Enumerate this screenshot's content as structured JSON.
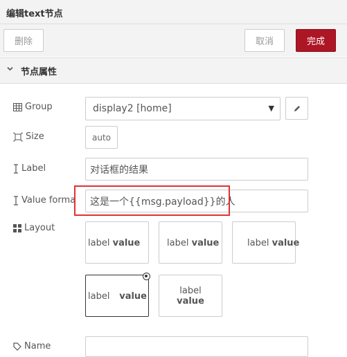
{
  "window": {
    "title": "编辑text节点"
  },
  "toolbar": {
    "delete_label": "删除",
    "cancel_label": "取消",
    "done_label": "完成"
  },
  "section": {
    "title": "节点属性"
  },
  "form": {
    "group": {
      "label": "Group",
      "value": "display2 [home]"
    },
    "size": {
      "label": "Size",
      "value": "auto"
    },
    "label": {
      "label": "Label",
      "value": "对话框的结果"
    },
    "value_format": {
      "label": "Value format",
      "value": "这是一个{{msg.payload}}的人"
    },
    "layout": {
      "label": "Layout",
      "options": [
        {
          "label": "label",
          "value": "value"
        },
        {
          "label": "label",
          "value": "value"
        },
        {
          "label": "label",
          "value": "value"
        },
        {
          "label": "label",
          "value": "value"
        },
        {
          "label": "label",
          "value": "value"
        }
      ]
    },
    "name": {
      "label": "Name"
    }
  },
  "colors": {
    "primary": "#ad1625",
    "highlight_box": "#e03131",
    "panel_bg": "#f3f3f3",
    "border": "#cccccc"
  }
}
